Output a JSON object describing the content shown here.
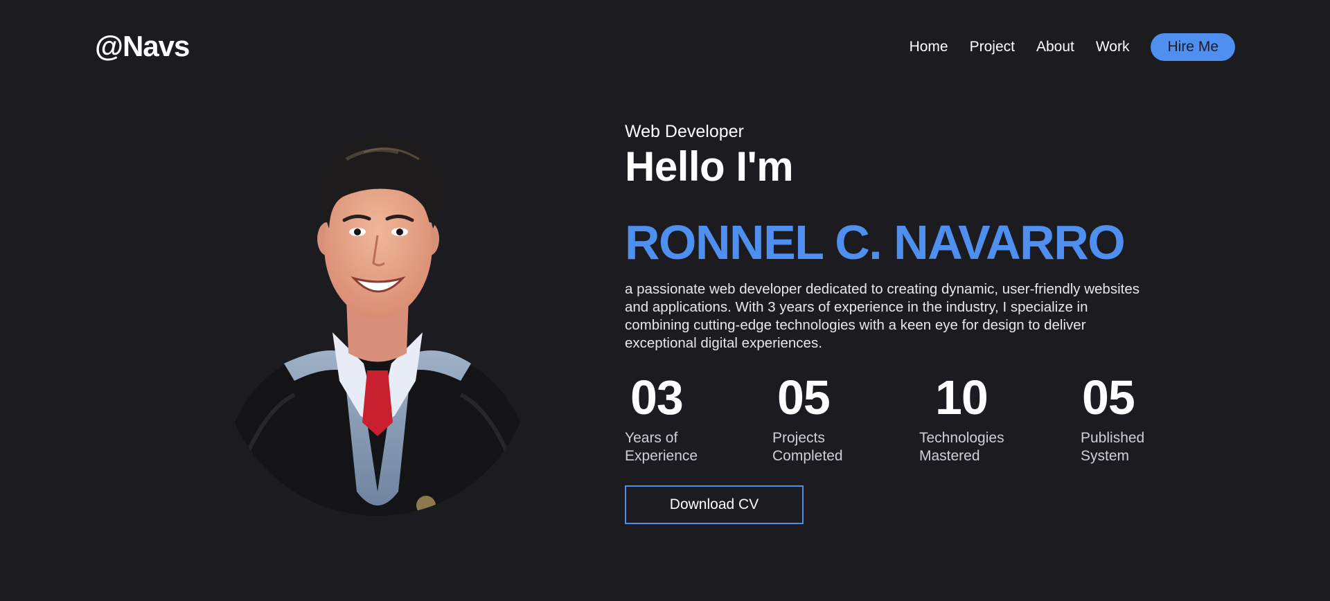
{
  "header": {
    "logo": "@Navs",
    "nav": [
      {
        "label": "Home"
      },
      {
        "label": "Project"
      },
      {
        "label": "About"
      },
      {
        "label": "Work"
      }
    ],
    "hire_label": "Hire Me"
  },
  "hero": {
    "role": "Web Developer",
    "greeting": "Hello I'm",
    "name": "RONNEL C. NAVARRO",
    "bio": "a passionate web developer dedicated to creating dynamic, user-friendly websites and applications. With 3 years of experience in the industry, I specialize in combining cutting-edge technologies with a keen eye for design to deliver exceptional digital experiences.",
    "stats": [
      {
        "value": "03",
        "label_line1": "Years of",
        "label_line2": "Experience"
      },
      {
        "value": "05",
        "label_line1": "Projects",
        "label_line2": "Completed"
      },
      {
        "value": "10",
        "label_line1": "Technologies",
        "label_line2": "Mastered"
      },
      {
        "value": "05",
        "label_line1": "Published",
        "label_line2": "System"
      }
    ],
    "download_label": "Download CV"
  },
  "colors": {
    "background": "#1c1b20",
    "accent": "#4f8ff0",
    "text": "#ffffff"
  }
}
